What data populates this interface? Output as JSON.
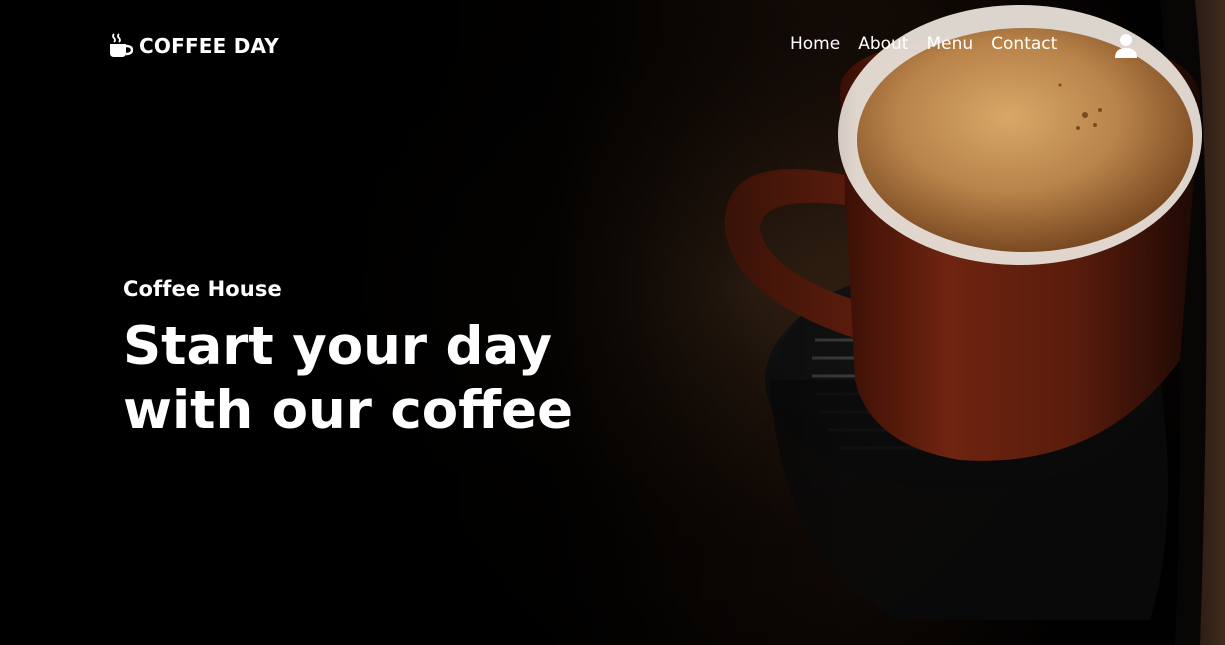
{
  "brand": {
    "name": "COFFEE DAY",
    "icon": "mug-hot-icon"
  },
  "nav": {
    "items": [
      {
        "label": "Home"
      },
      {
        "label": "About"
      },
      {
        "label": "Menu"
      },
      {
        "label": "Contact"
      }
    ],
    "user_icon": "user-icon"
  },
  "hero": {
    "eyebrow": "Coffee House",
    "headline": "Start your day with our coffee"
  },
  "colors": {
    "text": "#ffffff",
    "background": "#000000",
    "coffee_cup": "#7a2a12",
    "crema": "#c8955a"
  }
}
